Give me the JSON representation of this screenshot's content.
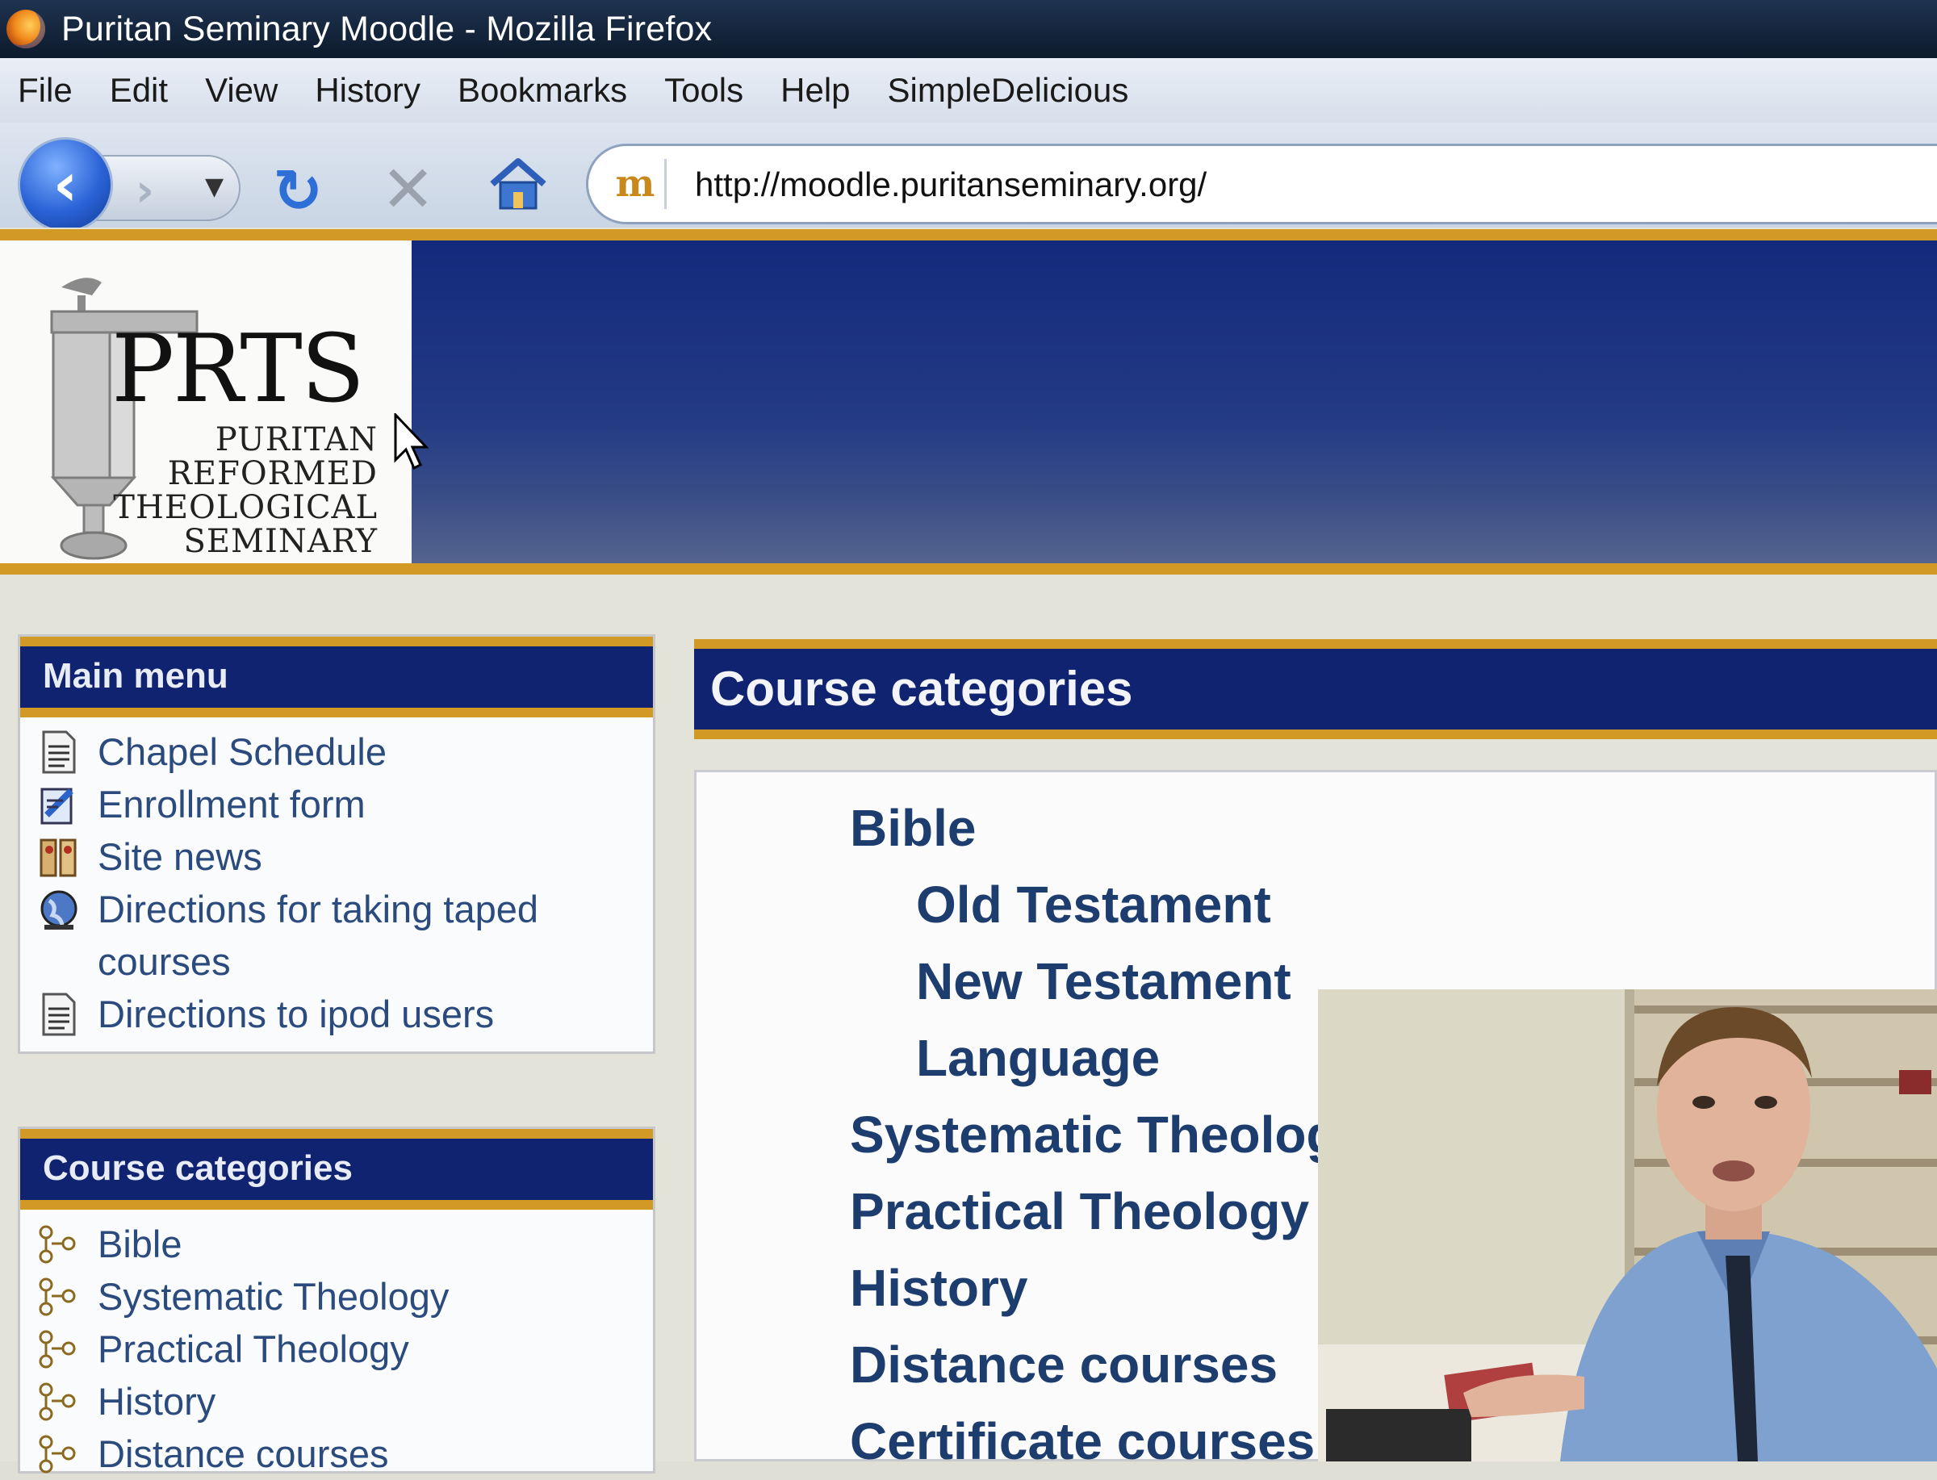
{
  "window": {
    "title": "Puritan Seminary Moodle - Mozilla Firefox"
  },
  "menubar": {
    "items": [
      "File",
      "Edit",
      "View",
      "History",
      "Bookmarks",
      "Tools",
      "Help",
      "SimpleDelicious"
    ]
  },
  "navbar": {
    "url": "http://moodle.puritanseminary.org/",
    "site_icon_text": "m"
  },
  "logo": {
    "acronym": "PRTS",
    "lines": [
      "PURITAN",
      "REFORMED",
      "THEOLOGICAL",
      "SEMINARY"
    ]
  },
  "main_menu": {
    "title": "Main menu",
    "items": [
      {
        "label": "Chapel Schedule",
        "icon": "document-icon"
      },
      {
        "label": "Enrollment form",
        "icon": "form-icon"
      },
      {
        "label": "Site news",
        "icon": "news-icon"
      },
      {
        "label": "Directions for taking taped courses",
        "icon": "globe-icon"
      },
      {
        "label": "Directions to ipod users",
        "icon": "document-icon"
      }
    ]
  },
  "side_categories": {
    "title": "Course categories",
    "items": [
      "Bible",
      "Systematic Theology",
      "Practical Theology",
      "History",
      "Distance courses"
    ]
  },
  "main": {
    "title": "Course categories",
    "categories": [
      {
        "label": "Bible",
        "level": 0
      },
      {
        "label": "Old Testament",
        "level": 1
      },
      {
        "label": "New Testament",
        "level": 1
      },
      {
        "label": "Language",
        "level": 1
      },
      {
        "label": "Systematic Theology",
        "level": 0
      },
      {
        "label": "Practical Theology",
        "level": 0
      },
      {
        "label": "History",
        "level": 0
      },
      {
        "label": "Distance courses",
        "level": 0
      },
      {
        "label": "Certificate courses",
        "level": 0
      }
    ]
  },
  "colors": {
    "header_blue": "#0f2370",
    "gold": "#d29a25",
    "link": "#1d3d6e"
  }
}
